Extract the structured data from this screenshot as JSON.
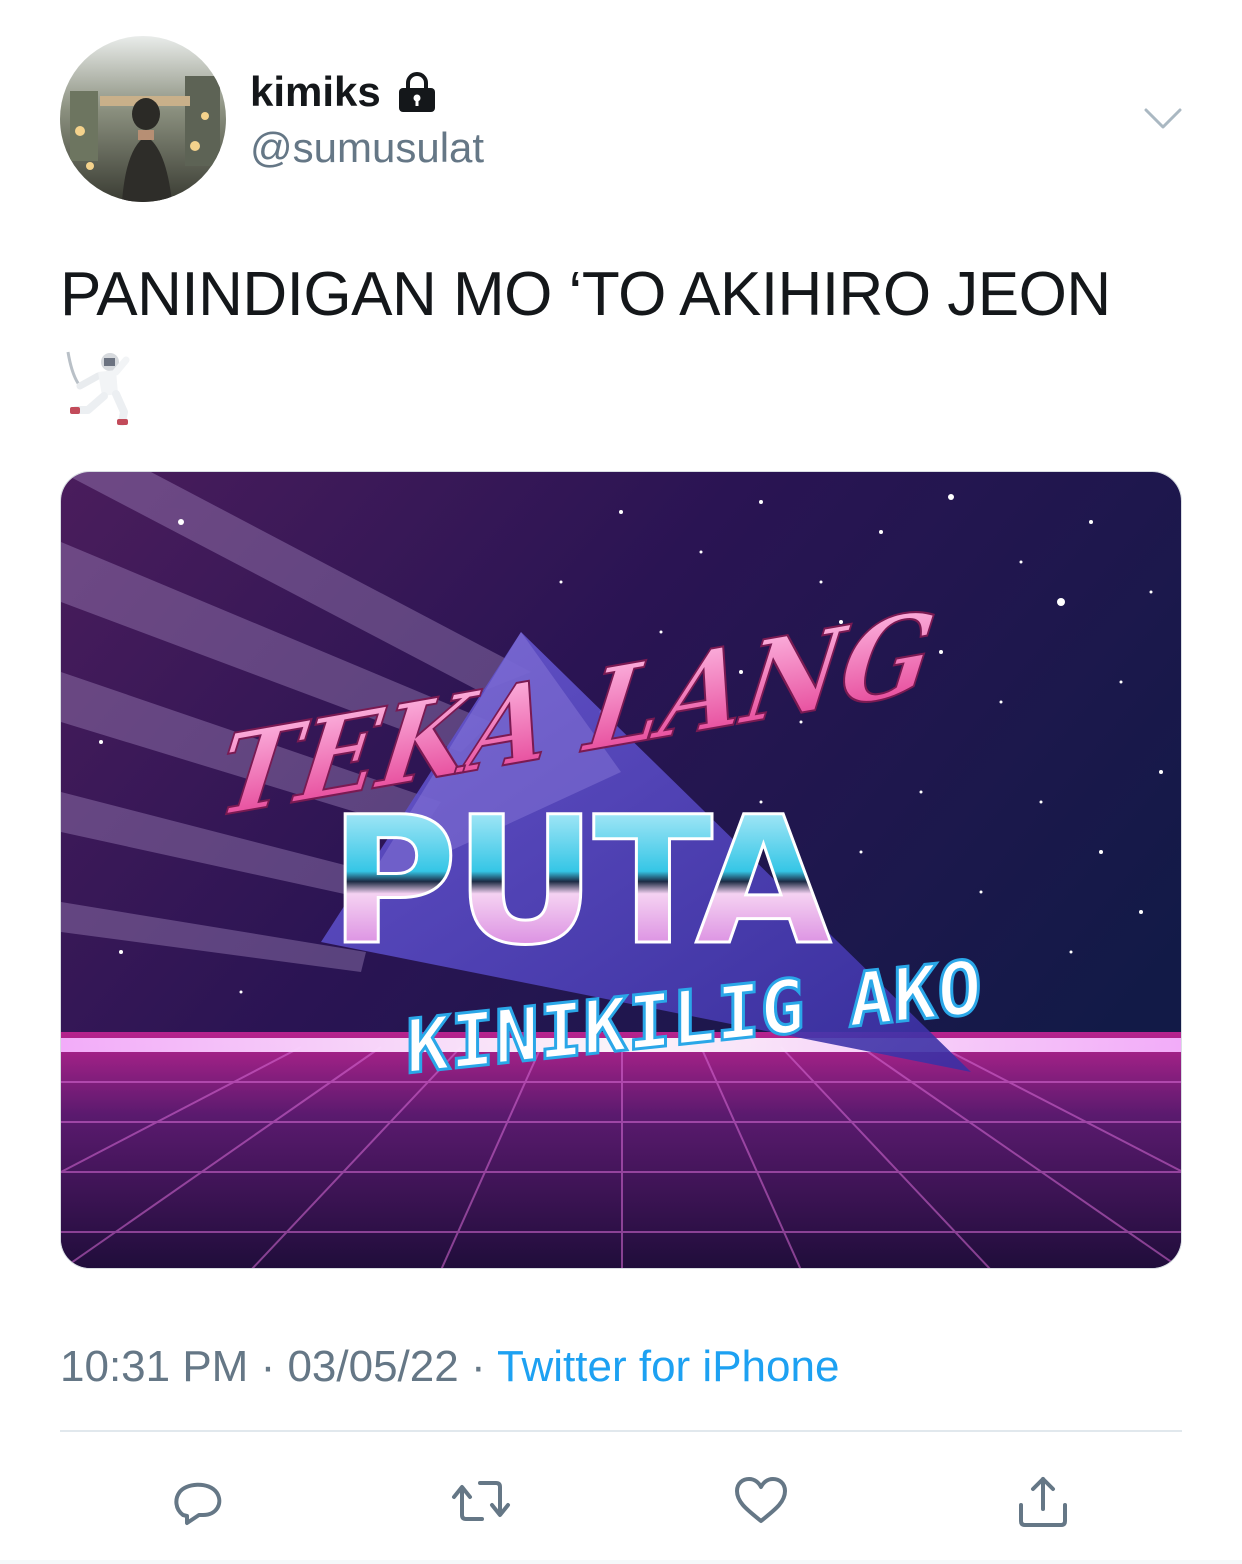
{
  "tweet": {
    "display_name": "kimiks",
    "handle": "@sumusulat",
    "text": "PANINDIGAN MO ‘TO AKIHIRO JEON",
    "emoji_name": "person-fencing",
    "timestamp_time": "10:31 PM",
    "separator": " · ",
    "timestamp_date": "03/05/22",
    "source": "Twitter for iPhone"
  },
  "media": {
    "line1": "TEKA LANG",
    "line2": "PUTA",
    "line3": "KINIKILIG AKO"
  },
  "icons": {
    "lock": "lock-icon",
    "menu": "chevron-down-icon",
    "reply": "reply-icon",
    "retweet": "retweet-icon",
    "like": "heart-icon",
    "share": "share-icon"
  },
  "colors": {
    "text": "#14171a",
    "secondary": "#657786",
    "link": "#1da1f2",
    "divider": "#e1e8ed"
  }
}
